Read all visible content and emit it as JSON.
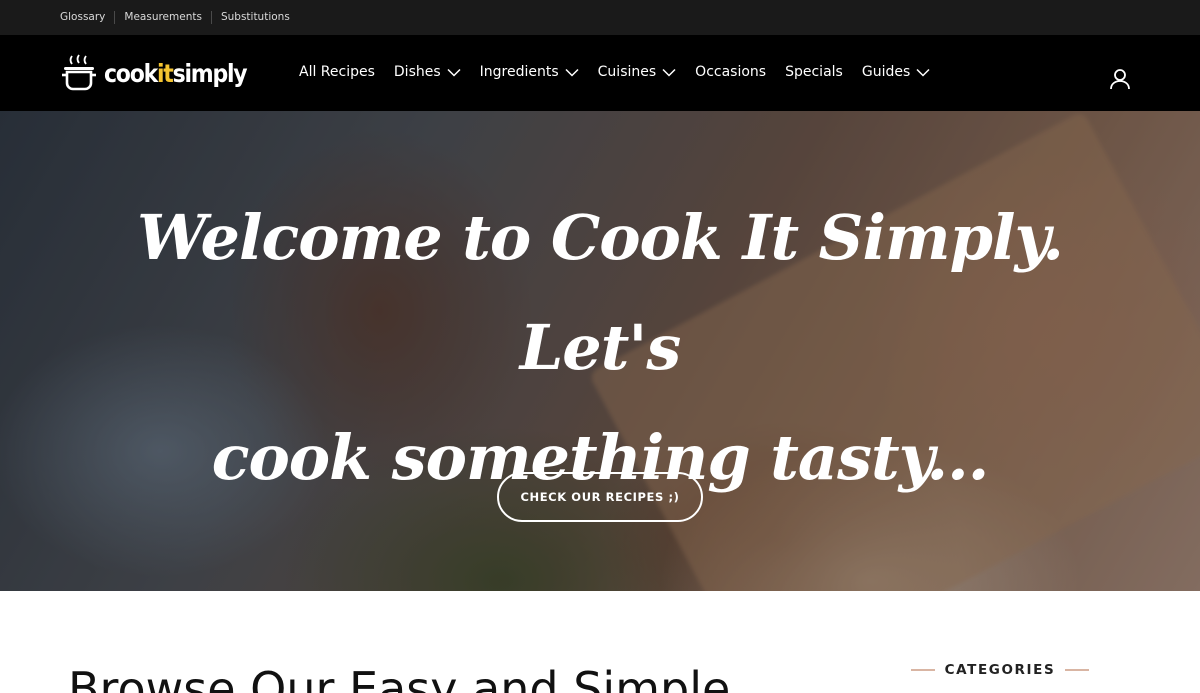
{
  "topbar": {
    "links": [
      "Glossary",
      "Measurements",
      "Substitutions"
    ]
  },
  "logo": {
    "text_before": "cook",
    "text_highlight": "it",
    "text_after": "simply"
  },
  "nav": {
    "items": [
      {
        "label": "All Recipes",
        "has_dropdown": false
      },
      {
        "label": "Dishes",
        "has_dropdown": true
      },
      {
        "label": "Ingredients",
        "has_dropdown": true
      },
      {
        "label": "Cuisines",
        "has_dropdown": true
      },
      {
        "label": "Occasions",
        "has_dropdown": false
      },
      {
        "label": "Specials",
        "has_dropdown": false
      },
      {
        "label": "Guides",
        "has_dropdown": true
      }
    ],
    "icons": {
      "user": "user-icon",
      "dropdown": "chevron-down-icon",
      "logo": "cooking-pot-icon"
    }
  },
  "hero": {
    "title_line1": "Welcome to Cook It Simply. Let's",
    "title_line2": "cook something tasty...",
    "button_label": "CHECK OUR RECIPES ;)"
  },
  "main": {
    "browse_title": "Browse Our Easy and Simple"
  },
  "sidebar": {
    "categories_heading": "CATEGORIES"
  },
  "colors": {
    "topbar_bg": "#1a1a1a",
    "navbar_bg": "#000000",
    "logo_accent": "#f4c430",
    "heading_rule": "#d9b5a3"
  }
}
